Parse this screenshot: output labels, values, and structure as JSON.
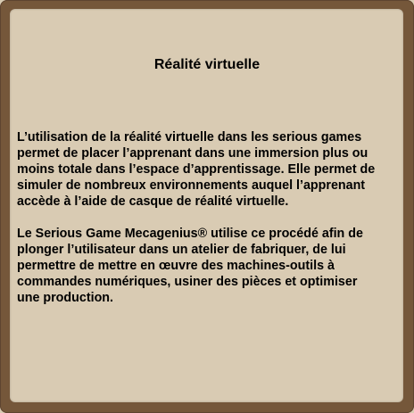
{
  "card": {
    "title": "Réalité virtuelle",
    "paragraphs": [
      "L’utilisation de la réalité virtuelle dans les serious games\npermet de placer l’apprenant dans une immersion plus ou\nmoins totale dans l’espace d’apprentissage. Elle permet de\nsimuler de nombreux environnements auquel l’apprenant\naccède à l’aide de casque de réalité virtuelle.",
      "Le Serious Game Mecagenius® utilise ce procédé afin de\nplonger l’utilisateur dans un atelier de fabriquer, de lui\npermettre de mettre en œuvre des machines-outils à\ncommandes numériques, usiner des pièces et optimiser\nune production."
    ]
  },
  "colors": {
    "frame": "#75573a",
    "background": "#d9cbb3",
    "text": "#000000"
  }
}
